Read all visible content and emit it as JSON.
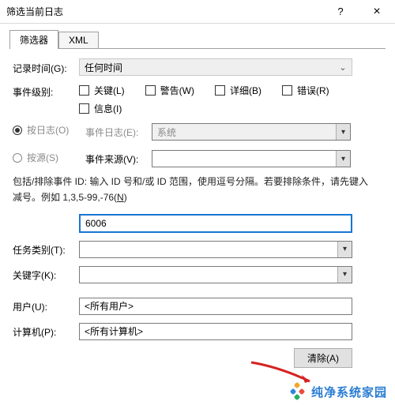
{
  "window": {
    "title": "筛选当前日志"
  },
  "tabs": {
    "filter": "筛选器",
    "xml": "XML"
  },
  "labels": {
    "logged": "记录时间(G):",
    "level": "事件级别:",
    "bylog": "按日志(O)",
    "bysource": "按源(S)",
    "eventlog": "事件日志(E):",
    "eventsource": "事件来源(V):",
    "task": "任务类别(T):",
    "keyword": "关键字(K):",
    "user": "用户(U):",
    "computer": "计算机(P):"
  },
  "fields": {
    "time_value": "任何时间",
    "eventlog_value": "系统",
    "eventsource_value": "",
    "eventid_value": "6006",
    "task_value": "",
    "keyword_value": "",
    "user_value": "<所有用户>",
    "computer_value": "<所有计算机>"
  },
  "checkboxes": {
    "critical": "关键(L)",
    "warning": "警告(W)",
    "verbose": "详细(B)",
    "error": "错误(R)",
    "info": "信息(I)"
  },
  "description_line1": "包括/排除事件 ID: 输入 ID 号和/或 ID 范围，使用逗号分隔。若要排除条件，请先键入",
  "description_line2_prefix": "减号。例如 1,3,5-99,-76(",
  "description_line2_link": "N",
  "description_line2_suffix": ")",
  "buttons": {
    "clear": "清除(A)"
  },
  "watermark": "纯净系统家园"
}
